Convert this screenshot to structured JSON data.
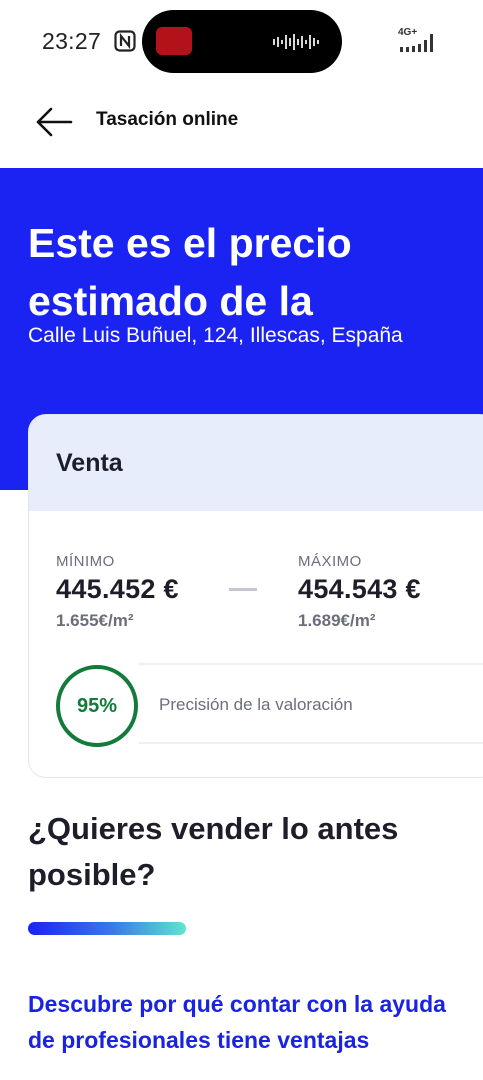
{
  "status_bar": {
    "time": "23:27",
    "network": "4G+",
    "icons": [
      "nfc-icon",
      "signal-icon"
    ]
  },
  "header": {
    "title": "Tasación online",
    "back_icon": "arrow-left-icon"
  },
  "hero": {
    "title": "Este es el precio estimado de la",
    "address": "Calle Luis Buñuel, 124, Illescas, España",
    "background": "#1a23f2"
  },
  "valuation": {
    "title": "Venta",
    "min": {
      "label": "MÍNIMO",
      "price": "445.452 €",
      "per_sqm": "1.655€/m²"
    },
    "max": {
      "label": "MÁXIMO",
      "price": "454.543 €",
      "per_sqm": "1.689€/m²"
    },
    "precision": {
      "value": "95%",
      "label": "Precisión de la valoración",
      "color": "#127b3a"
    }
  },
  "sell": {
    "title": "¿Quieres vender lo antes posible?",
    "link": "Descubre por qué contar con la ayuda de profesionales tiene ventajas",
    "link_color": "#1a23e0"
  }
}
